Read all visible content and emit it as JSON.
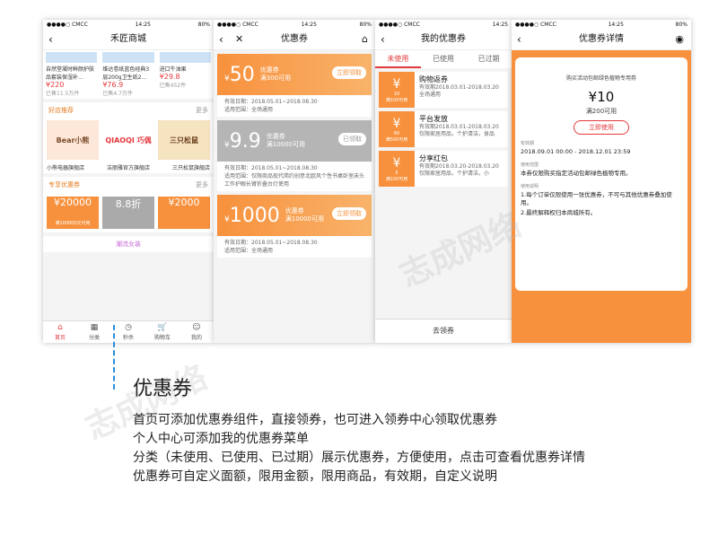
{
  "status": {
    "carrier": "●●●●○ CMCC",
    "time": "14:25",
    "battery": "80%"
  },
  "phone1": {
    "title": "禾匠商城",
    "products": [
      {
        "name": "自然堂凝时鲜颜护肤品套装保湿补…",
        "price": "¥220",
        "sold": "已售11.5万件"
      },
      {
        "name": "维达卷纸蓝色经典3层200g卫生纸2…",
        "price": "¥76.9",
        "sold": "已售4.7万件"
      },
      {
        "name": "进口牛油果",
        "price": "¥29.8",
        "sold": "已售452件"
      }
    ],
    "shop_section": "好店推荐",
    "more": "更多",
    "shops": [
      "Bear小熊",
      "QIAOQI 巧偶",
      "三只松鼠"
    ],
    "shop_names": [
      "小熊电器旗舰店",
      "洁丽雅官方旗舰店",
      "三只松鼠旗舰店"
    ],
    "coupon_section": "专享优惠券",
    "mini_coupons": [
      {
        "amount": "¥20000",
        "sub": "满100000元可用"
      },
      {
        "amount": "8.8折",
        "sub": ""
      },
      {
        "amount": "¥2000",
        "sub": ""
      }
    ],
    "women_section": "潮流女装",
    "tabs": [
      {
        "icon": "⌂",
        "label": "首页"
      },
      {
        "icon": "▦",
        "label": "分类"
      },
      {
        "icon": "◷",
        "label": "秒杀"
      },
      {
        "icon": "🛒",
        "label": "购物车"
      },
      {
        "icon": "☺",
        "label": "我的"
      }
    ]
  },
  "phone2": {
    "title": "优惠券",
    "coupons": [
      {
        "amount": "50",
        "label": "优惠券",
        "cond": "满300可用",
        "btn": "立即领取",
        "date": "有效日期：2018.05.01~2018.08.30",
        "scope": "适用范围：全场通用",
        "style": "orange"
      },
      {
        "amount": "9.9",
        "label": "优惠券",
        "cond": "满10000可用",
        "btn": "已领取",
        "date": "有效日期：2018.05.01~2018.08.30",
        "scope": "适用范围：仅限商品现代简约创意北欧风个性书桌卧室床头工作护眼长臂折叠台灯使用",
        "style": "grey"
      },
      {
        "amount": "1000",
        "label": "优惠券",
        "cond": "满10000可用",
        "btn": "立即领取",
        "date": "有效日期：2018.05.01~2018.08.30",
        "scope": "适用范围：全场通用",
        "style": "orange"
      }
    ]
  },
  "phone3": {
    "title": "我的优惠券",
    "tabs": [
      "未使用",
      "已使用",
      "已过期"
    ],
    "coupons": [
      {
        "amount": "10",
        "cond": "满100可用",
        "name": "购物返券",
        "date": "有效期2018.03.01-2018.03.20",
        "scope": "全场通用"
      },
      {
        "amount": "60",
        "cond": "满500可用",
        "name": "平台发放",
        "date": "有效期2018.03.01-2018.03.20",
        "scope": "仅限家居用品，个护清洁，食品"
      },
      {
        "amount": "5",
        "cond": "满100可用",
        "name": "分享红包",
        "date": "有效期2018.03.20-2018.03.20",
        "scope": "仅限家居用品，个护清洁，小"
      }
    ],
    "footer": "去领券"
  },
  "phone4": {
    "title": "优惠券详情",
    "card_title": "购买活动包邮绿色植物专用券",
    "amount": "¥10",
    "cond": "满200可用",
    "btn": "立即使用",
    "valid_label": "有效期",
    "valid": "2018.09.01 00:00 - 2018.12.01 23:59",
    "scope_label": "使用范围",
    "scope": "本券仅限购买指定活动包邮绿色植物专用。",
    "rules_label": "使用说明",
    "rules": [
      "1.每个订单仅限使用一张优惠券，不可与其他优惠券叠加使用。",
      "2.最终解释权归本商城所有。"
    ]
  },
  "caption": {
    "title": "优惠券",
    "lines": [
      "首页可添加优惠券组件，直接领券，也可进入领券中心领取优惠券",
      "个人中心可添加我的优惠券菜单",
      "分类（未使用、已使用、已过期）展示优惠券，方便使用，点击可查看优惠券详情",
      "优惠券可自定义面额，限用金额，限用商品，有效期，自定义说明"
    ]
  },
  "watermark": "志成网络",
  "colors": {
    "accent": "#f7913d",
    "price": "#e4393c",
    "guide": "#2a8fd6"
  }
}
